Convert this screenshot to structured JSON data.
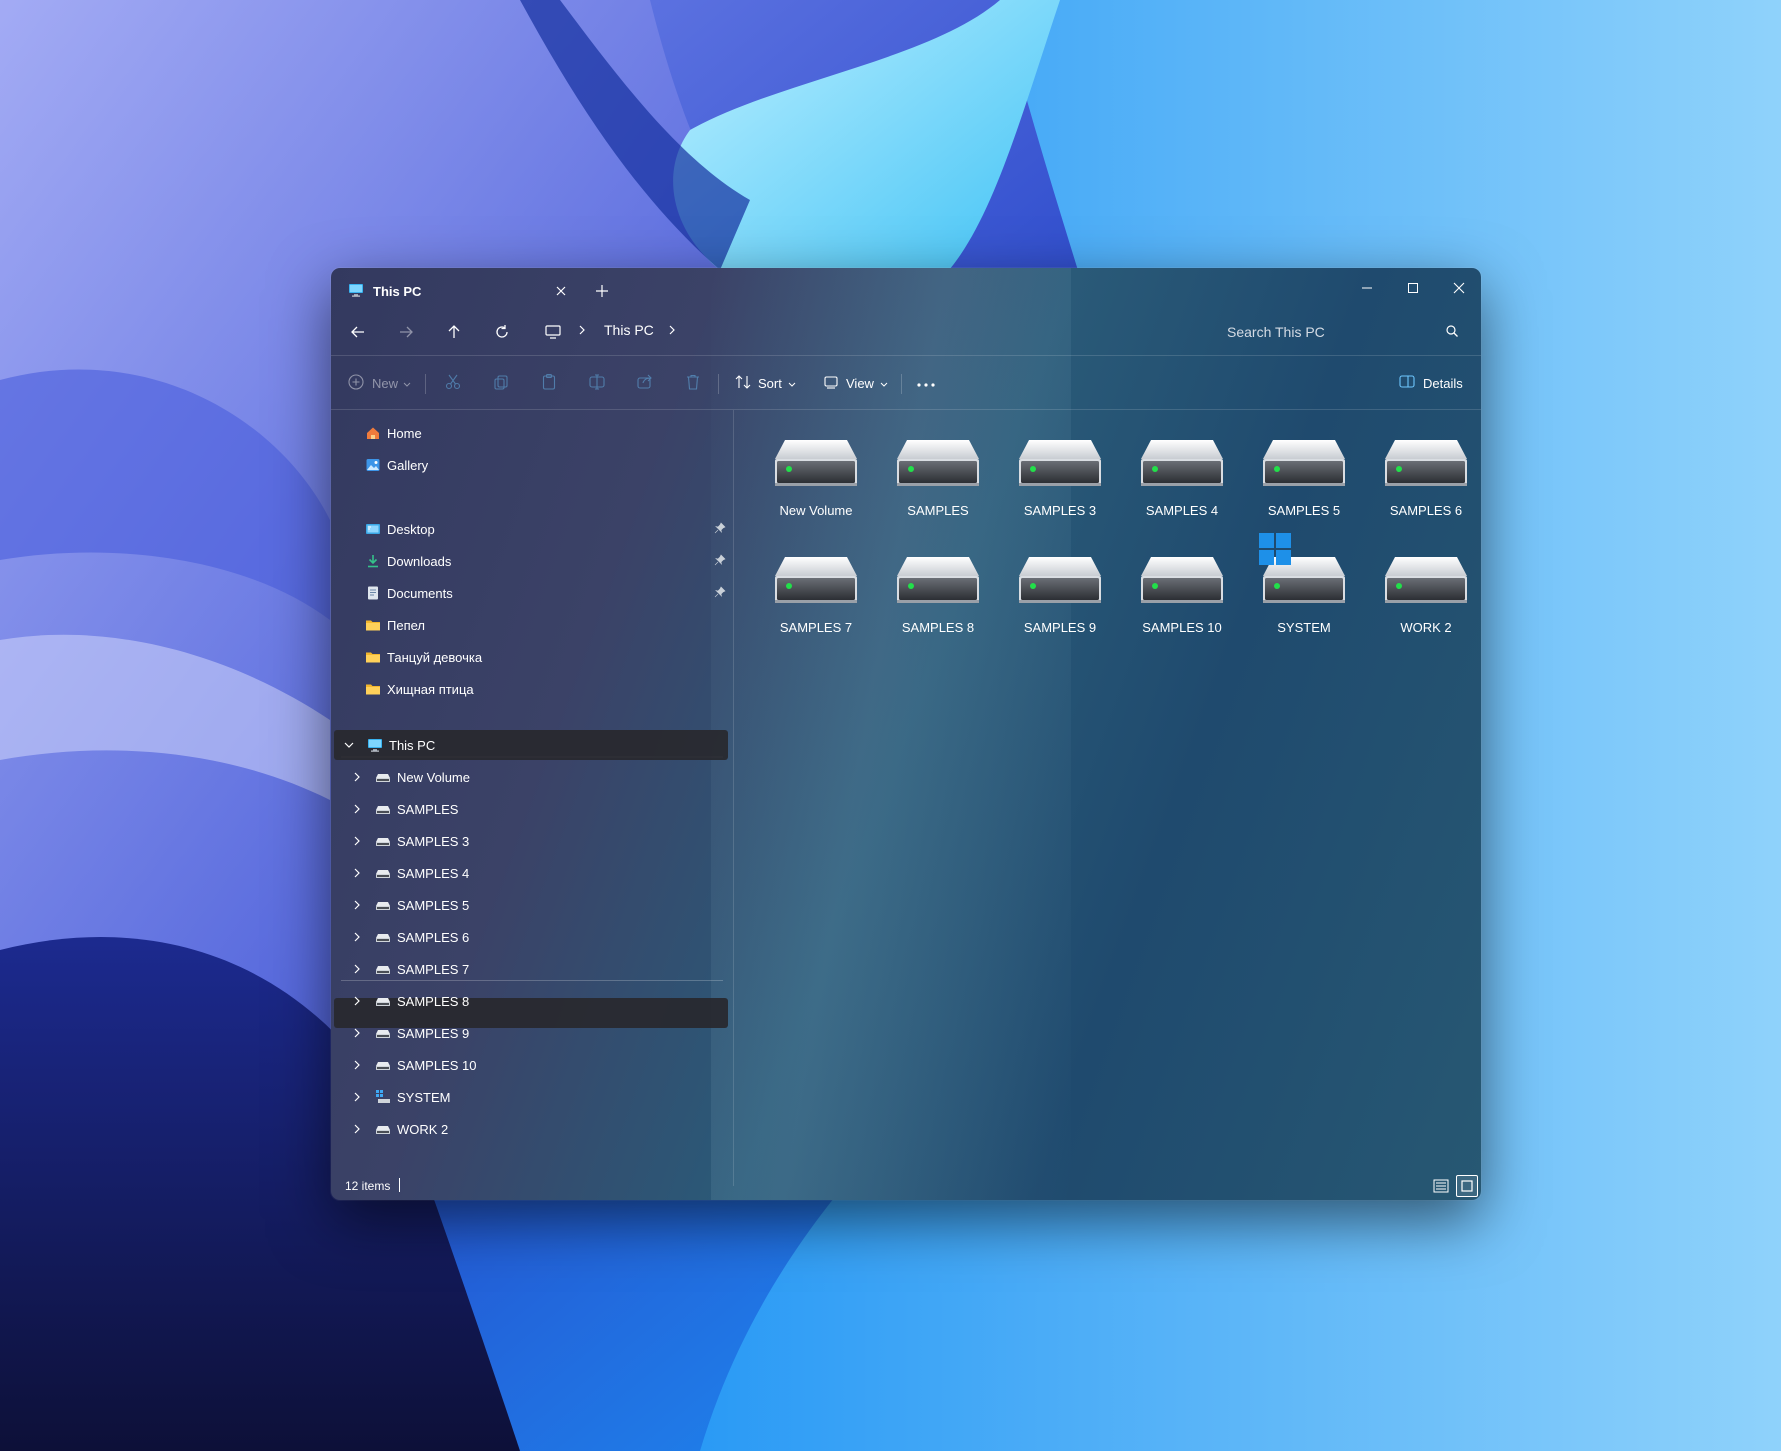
{
  "window": {
    "tab_title": "This PC",
    "address_current": "This PC",
    "search_placeholder": "Search This PC"
  },
  "commandbar": {
    "new_label": "New",
    "sort_label": "Sort",
    "view_label": "View",
    "details_label": "Details"
  },
  "sidebar": {
    "top_items": [
      {
        "label": "Home",
        "icon": "home-icon"
      },
      {
        "label": "Gallery",
        "icon": "gallery-icon"
      }
    ],
    "quick_access": [
      {
        "label": "Desktop",
        "icon": "desktop-folder-icon",
        "pinned": true
      },
      {
        "label": "Downloads",
        "icon": "downloads-folder-icon",
        "pinned": true
      },
      {
        "label": "Documents",
        "icon": "documents-folder-icon",
        "pinned": true
      },
      {
        "label": "Пепел",
        "icon": "folder-icon",
        "pinned": false
      },
      {
        "label": "Танцуй девочка",
        "icon": "folder-icon",
        "pinned": false
      },
      {
        "label": "Хищная птица",
        "icon": "folder-icon",
        "pinned": false
      }
    ],
    "this_pc": {
      "label": "This PC",
      "expanded": true
    },
    "drives": [
      {
        "label": "New Volume"
      },
      {
        "label": "SAMPLES"
      },
      {
        "label": "SAMPLES 3"
      },
      {
        "label": "SAMPLES 4"
      },
      {
        "label": "SAMPLES 5"
      },
      {
        "label": "SAMPLES 6"
      },
      {
        "label": "SAMPLES 7"
      },
      {
        "label": "SAMPLES 8"
      },
      {
        "label": "SAMPLES 9"
      },
      {
        "label": "SAMPLES 10"
      },
      {
        "label": "SYSTEM"
      },
      {
        "label": "WORK 2"
      }
    ]
  },
  "content": {
    "drives": [
      {
        "label": "New Volume",
        "system": false
      },
      {
        "label": "SAMPLES",
        "system": false
      },
      {
        "label": "SAMPLES 3",
        "system": false
      },
      {
        "label": "SAMPLES 4",
        "system": false
      },
      {
        "label": "SAMPLES 5",
        "system": false
      },
      {
        "label": "SAMPLES 6",
        "system": false
      },
      {
        "label": "SAMPLES 7",
        "system": false
      },
      {
        "label": "SAMPLES 8",
        "system": false
      },
      {
        "label": "SAMPLES 9",
        "system": false
      },
      {
        "label": "SAMPLES 10",
        "system": false
      },
      {
        "label": "SYSTEM",
        "system": true
      },
      {
        "label": "WORK 2",
        "system": false
      }
    ]
  },
  "status": {
    "item_count": "12 items"
  },
  "colors": {
    "accent": "#4cc2ff",
    "drive_led": "#22e04a",
    "selected_row": "#28282e"
  }
}
